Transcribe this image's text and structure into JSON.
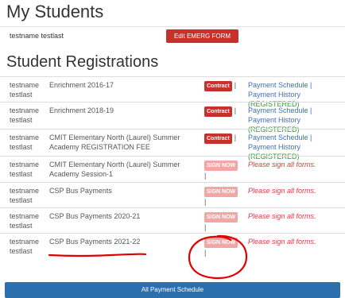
{
  "my_students": {
    "heading": "My Students",
    "student": {
      "name": "testname testlast",
      "button": "Edit EMERG FORM"
    }
  },
  "registrations": {
    "heading": "Student Registrations",
    "rows": [
      {
        "name": "testname testlast",
        "program": "Enrichment 2016-17",
        "action": "Contract",
        "action_type": "contract",
        "sep": "|",
        "pay_link": "Payment Schedule | Payment History",
        "pay_status": "(REGISTERED)"
      },
      {
        "name": "testname testlast",
        "program": "Enrichment 2018-19",
        "action": "Contract",
        "action_type": "contract",
        "sep": "|",
        "pay_link": "Payment Schedule | Payment History",
        "pay_status": "(REGISTERED)"
      },
      {
        "name": "testname testlast",
        "program": "CMIT Elementary North (Laurel) Summer Academy REGISTRATION FEE",
        "action": "Contract",
        "action_type": "contract",
        "sep": "|",
        "pay_link": "Payment Schedule | Payment History",
        "pay_status": "(REGISTERED)"
      },
      {
        "name": "testname testlast",
        "program": "CMIT Elementary North (Laurel) Summer Academy Session-1",
        "action": "SIGN NOW",
        "action_type": "sign",
        "sep": "|",
        "warning": "Please sign all forms."
      },
      {
        "name": "testname testlast",
        "program": "CSP Bus Payments",
        "action": "SIGN NOW",
        "action_type": "sign",
        "sep": "|",
        "warning": "Please sign all forms."
      },
      {
        "name": "testname testlast",
        "program": "CSP Bus Payments 2020-21",
        "action": "SIGN NOW",
        "action_type": "sign",
        "sep": "|",
        "warning": "Please sign all forms."
      },
      {
        "name": "testname testlast",
        "program": "CSP Bus Payments 2021-22",
        "action": "SIGN NOW",
        "action_type": "sign",
        "sep": "|",
        "warning": "Please sign all forms."
      }
    ]
  },
  "footer": {
    "all_payment_button": "All Payment Schedule"
  },
  "colors": {
    "danger": "#c9302c",
    "sign_disabled": "#f2a6a6",
    "link": "#3a6fc4",
    "registered": "#2e9c3a",
    "warning": "#e23b3b",
    "primary": "#2c6faf",
    "annotation": "#e00000"
  }
}
